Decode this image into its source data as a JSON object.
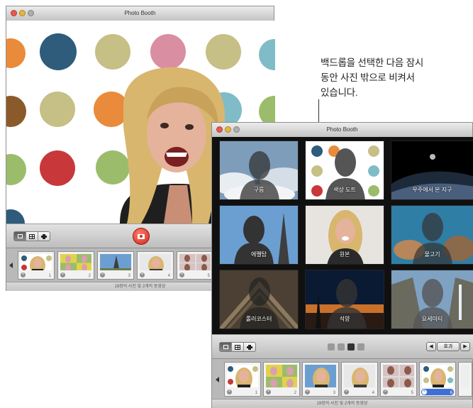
{
  "callout": {
    "lines": [
      "백드롭을 선택한 다음 잠시",
      "동안 사진 밖으로 비켜서",
      "있습니다."
    ]
  },
  "main_window": {
    "title": "Photo Booth",
    "status": "19장의 사진 및 2개의 동영상",
    "thumbnails": [
      {
        "num": "1",
        "icon": "portrait"
      },
      {
        "num": "2",
        "icon": "four-up"
      },
      {
        "num": "3",
        "icon": "eiffel"
      },
      {
        "num": "4",
        "icon": "portrait"
      },
      {
        "num": "5",
        "icon": "four-up"
      }
    ]
  },
  "effects_window": {
    "title": "Photo Booth",
    "effects": [
      {
        "label": "구름",
        "icon": "clouds-silhouette"
      },
      {
        "label": "색상 도트",
        "icon": "dots-silhouette"
      },
      {
        "label": "우주에서 본 지구",
        "icon": "earth-space"
      },
      {
        "label": "에펠탑",
        "icon": "eiffel-silhouette"
      },
      {
        "label": "원본",
        "icon": "original-portrait"
      },
      {
        "label": "물고기",
        "icon": "fish-silhouette"
      },
      {
        "label": "롤러코스터",
        "icon": "rollercoaster-silhouette"
      },
      {
        "label": "석양",
        "icon": "sunset-silhouette"
      },
      {
        "label": "요세미티",
        "icon": "yosemite-silhouette"
      }
    ],
    "effects_button": "효과",
    "page_count": 4,
    "current_page": 3,
    "status": "19장의 사진 및 2개의 동영상",
    "thumbnails": [
      {
        "num": "1",
        "icon": "portrait"
      },
      {
        "num": "2",
        "icon": "four-up"
      },
      {
        "num": "3",
        "icon": "portrait"
      },
      {
        "num": "4",
        "icon": "portrait"
      },
      {
        "num": "5",
        "icon": "four-up"
      },
      {
        "num": "6",
        "icon": "dots-portrait",
        "selected": true
      }
    ]
  },
  "colors": {
    "shutter": "#d02a1c",
    "selection": "#3d6fd6",
    "dot_red": "#c8373a",
    "dot_teal": "#2e5c7a",
    "dot_khaki": "#c6bf86",
    "dot_pink": "#d98fa1",
    "dot_orange": "#e98b3a",
    "dot_green": "#9bbd6b",
    "dot_brown": "#8b5a2b",
    "dot_sky": "#7fbcc8"
  }
}
